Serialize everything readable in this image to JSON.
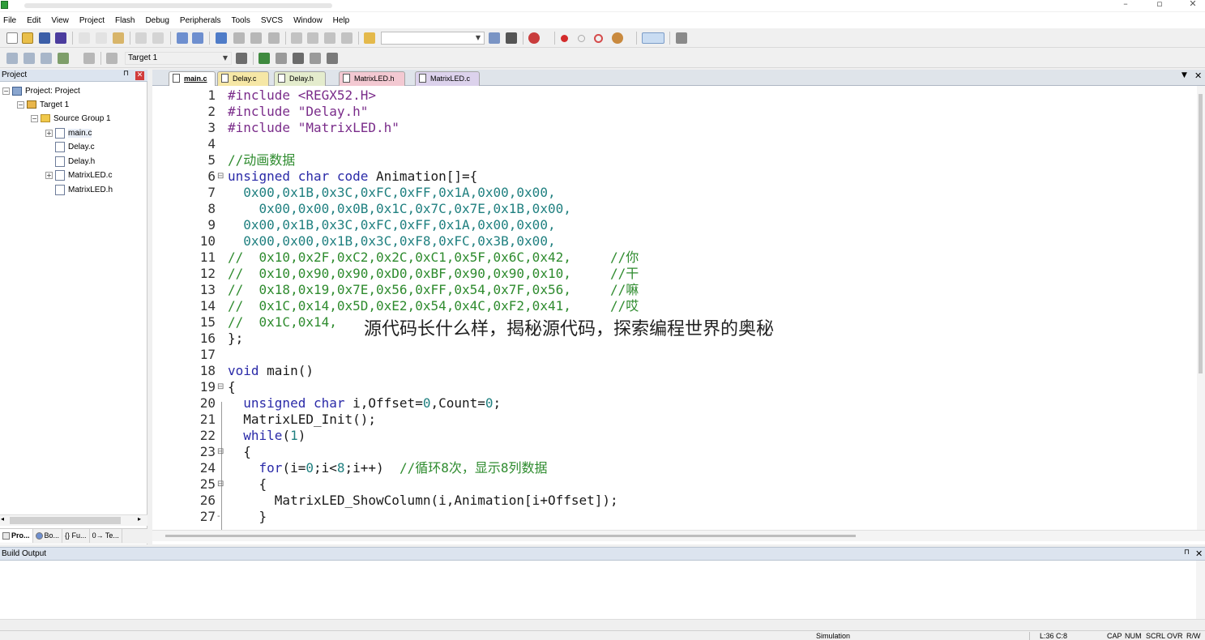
{
  "menu": [
    "File",
    "Edit",
    "View",
    "Project",
    "Flash",
    "Debug",
    "Peripherals",
    "Tools",
    "SVCS",
    "Window",
    "Help"
  ],
  "toolbar2": {
    "target_combo": "Target 1"
  },
  "project_panel": {
    "title": "Project",
    "tree": [
      {
        "label": "Project: Project",
        "icon": "project-icon"
      },
      {
        "label": "Target 1",
        "icon": "target-icon"
      },
      {
        "label": "Source Group 1",
        "icon": "folder-icon"
      },
      {
        "label": "main.c",
        "icon": "file-icon"
      },
      {
        "label": "Delay.c",
        "icon": "file-icon"
      },
      {
        "label": "Delay.h",
        "icon": "file-icon"
      },
      {
        "label": "MatrixLED.c",
        "icon": "file-icon"
      },
      {
        "label": "MatrixLED.h",
        "icon": "file-icon"
      }
    ],
    "bottom_tabs": [
      "Pro...",
      "Bo...",
      "{} Fu...",
      "0→ Te..."
    ]
  },
  "editor": {
    "tabs": [
      {
        "label": "main.c",
        "color": "#ffffff"
      },
      {
        "label": "Delay.c",
        "color": "#f6e7a6"
      },
      {
        "label": "Delay.h",
        "color": "#e4eccd"
      },
      {
        "label": "MatrixLED.h",
        "color": "#f3c9d2"
      },
      {
        "label": "MatrixLED.c",
        "color": "#dcd2ec"
      }
    ],
    "lines": [
      {
        "n": "1",
        "fold": "",
        "tokens": [
          [
            "pp",
            "#include <REGX52.H>"
          ]
        ]
      },
      {
        "n": "2",
        "fold": "",
        "tokens": [
          [
            "pp",
            "#include \"Delay.h\""
          ]
        ]
      },
      {
        "n": "3",
        "fold": "",
        "tokens": [
          [
            "pp",
            "#include \"MatrixLED.h\""
          ]
        ]
      },
      {
        "n": "4",
        "fold": "",
        "tokens": []
      },
      {
        "n": "5",
        "fold": "",
        "tokens": [
          [
            "cm",
            "//动画数据"
          ]
        ]
      },
      {
        "n": "6",
        "fold": "⊟",
        "tokens": [
          [
            "kw",
            "unsigned char code "
          ],
          [
            "id",
            "Animation[]={"
          ]
        ]
      },
      {
        "n": "7",
        "fold": "",
        "tokens": [
          [
            "num",
            "  0x00,0x1B,0x3C,0xFC,0xFF,0x1A,0x00,0x00,"
          ]
        ]
      },
      {
        "n": "8",
        "fold": "",
        "tokens": [
          [
            "num",
            "    0x00,0x00,0x0B,0x1C,0x7C,0x7E,0x1B,0x00,"
          ]
        ]
      },
      {
        "n": "9",
        "fold": "",
        "tokens": [
          [
            "num",
            "  0x00,0x1B,0x3C,0xFC,0xFF,0x1A,0x00,0x00,"
          ]
        ]
      },
      {
        "n": "10",
        "fold": "",
        "tokens": [
          [
            "num",
            "  0x00,0x00,0x1B,0x3C,0xF8,0xFC,0x3B,0x00,"
          ]
        ]
      },
      {
        "n": "11",
        "fold": "",
        "tokens": [
          [
            "cm",
            "//  0x10,0x2F,0xC2,0x2C,0xC1,0x5F,0x6C,0x42,     //你"
          ]
        ]
      },
      {
        "n": "12",
        "fold": "",
        "tokens": [
          [
            "cm",
            "//  0x10,0x90,0x90,0xD0,0xBF,0x90,0x90,0x10,     //干"
          ]
        ]
      },
      {
        "n": "13",
        "fold": "",
        "tokens": [
          [
            "cm",
            "//  0x18,0x19,0x7E,0x56,0xFF,0x54,0x7F,0x56,     //嘛"
          ]
        ]
      },
      {
        "n": "14",
        "fold": "",
        "tokens": [
          [
            "cm",
            "//  0x1C,0x14,0x5D,0xE2,0x54,0x4C,0xF2,0x41,     //哎"
          ]
        ]
      },
      {
        "n": "15",
        "fold": "",
        "tokens": [
          [
            "cm",
            "//  0x1C,0x14,"
          ]
        ]
      },
      {
        "n": "16",
        "fold": "",
        "tokens": [
          [
            "id",
            "};"
          ]
        ]
      },
      {
        "n": "17",
        "fold": "",
        "tokens": []
      },
      {
        "n": "18",
        "fold": "",
        "tokens": [
          [
            "kw",
            "void "
          ],
          [
            "id",
            "main()"
          ]
        ]
      },
      {
        "n": "19",
        "fold": "⊟",
        "tokens": [
          [
            "id",
            "{"
          ]
        ]
      },
      {
        "n": "20",
        "fold": "",
        "tokens": [
          [
            "kw",
            "  unsigned char "
          ],
          [
            "id",
            "i,Offset="
          ],
          [
            "num",
            "0"
          ],
          [
            "id",
            ",Count="
          ],
          [
            "num",
            "0"
          ],
          [
            "id",
            ";"
          ]
        ]
      },
      {
        "n": "21",
        "fold": "",
        "tokens": [
          [
            "id",
            "  MatrixLED_Init();"
          ]
        ]
      },
      {
        "n": "22",
        "fold": "",
        "tokens": [
          [
            "kw",
            "  while"
          ],
          [
            "id",
            "("
          ],
          [
            "num",
            "1"
          ],
          [
            "id",
            ")"
          ]
        ]
      },
      {
        "n": "23",
        "fold": "⊟",
        "tokens": [
          [
            "id",
            "  {"
          ]
        ]
      },
      {
        "n": "24",
        "fold": "",
        "tokens": [
          [
            "kw",
            "    for"
          ],
          [
            "id",
            "(i="
          ],
          [
            "num",
            "0"
          ],
          [
            "id",
            ";i<"
          ],
          [
            "num",
            "8"
          ],
          [
            "id",
            ";i++)  "
          ],
          [
            "cm",
            "//循环8次，显示8列数据"
          ]
        ]
      },
      {
        "n": "25",
        "fold": "⊟",
        "tokens": [
          [
            "id",
            "    {"
          ]
        ]
      },
      {
        "n": "26",
        "fold": "",
        "tokens": [
          [
            "id",
            "      MatrixLED_ShowColumn(i,Animation[i+Offset]);"
          ]
        ]
      },
      {
        "n": "27",
        "fold": "-",
        "tokens": [
          [
            "id",
            "    }"
          ]
        ]
      }
    ]
  },
  "overlay_caption": "源代码长什么样，揭秘源代码，探索编程世界的奥秘",
  "build_output": {
    "title": "Build Output"
  },
  "statusbar": {
    "mode": "Simulation",
    "position": "L:36 C:8",
    "indicators": [
      "CAP",
      "NUM",
      "SCRL",
      "OVR",
      "R/W"
    ]
  }
}
